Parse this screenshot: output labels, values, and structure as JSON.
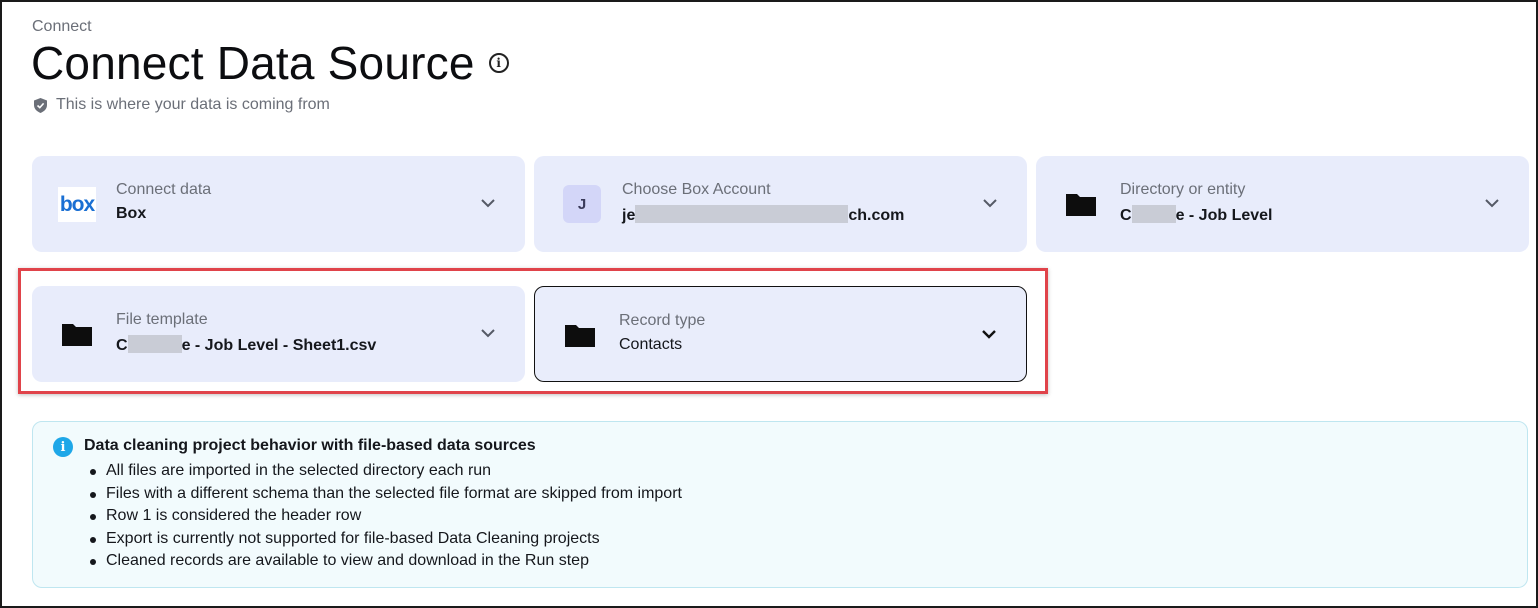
{
  "header": {
    "breadcrumb": "Connect",
    "title": "Connect Data Source",
    "subtitle": "This is where your data is coming from"
  },
  "cards": {
    "connect_data": {
      "label": "Connect data",
      "value": "Box",
      "logo_text": "box"
    },
    "box_account": {
      "label": "Choose Box Account",
      "avatar_letter": "J",
      "value_prefix": "je",
      "value_suffix": "ch.com"
    },
    "directory": {
      "label": "Directory or entity",
      "value_prefix": "C",
      "value_suffix": "e - Job Level"
    },
    "file_template": {
      "label": "File template",
      "value_prefix": "C",
      "value_suffix": "e - Job Level - Sheet1.csv"
    },
    "record_type": {
      "label": "Record type",
      "value": "Contacts"
    }
  },
  "notice": {
    "title": "Data cleaning project behavior with file-based data sources",
    "items": [
      "All files are imported in the selected directory each run",
      "Files with a different schema than the selected file format are skipped from import",
      "Row 1 is considered the header row",
      "Export is currently not supported for file-based Data Cleaning projects",
      "Cleaned records are available to view and download in the Run step"
    ]
  },
  "colors": {
    "card_bg": "#e8ecfb",
    "highlight": "#e0434a",
    "info_blue": "#1ea7e8",
    "box_blue": "#1a6fd3"
  },
  "icons": {
    "info": "info-circle-icon",
    "shield": "shield-icon",
    "folder": "folder-icon",
    "chevron": "chevron-down-icon"
  }
}
